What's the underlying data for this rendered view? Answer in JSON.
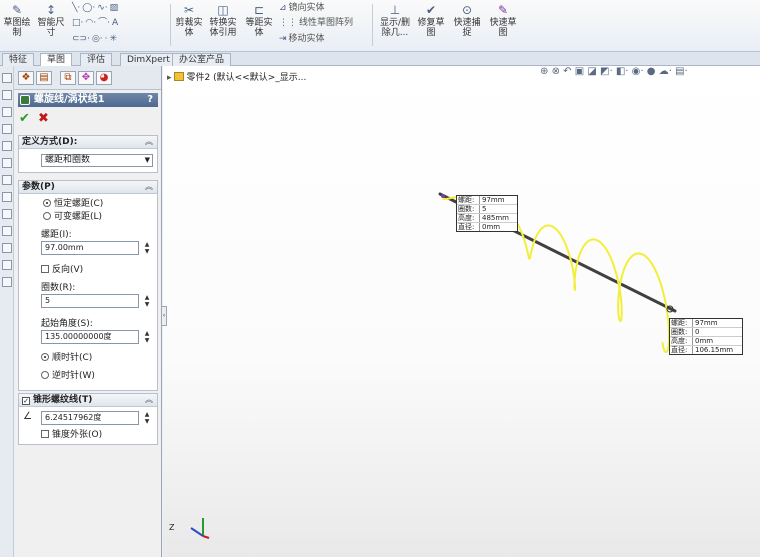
{
  "ribbon": {
    "buttons": [
      {
        "label": "草图绘\n制",
        "icon": "pencil-icon"
      },
      {
        "label": "智能尺\n寸",
        "icon": "dimension-icon"
      },
      {
        "label": "剪裁实\n体",
        "icon": "trim-icon"
      },
      {
        "label": "转换实\n体引用",
        "icon": "convert-icon"
      },
      {
        "label": "等距实\n体",
        "icon": "offset-icon"
      },
      {
        "label": "显示/删\n除几...",
        "icon": "relations-icon"
      },
      {
        "label": "修复草\n图",
        "icon": "repair-icon"
      },
      {
        "label": "快速捕\n捉",
        "icon": "snap-icon"
      },
      {
        "label": "快速草\n图",
        "icon": "rapid-sketch-icon"
      }
    ],
    "small": {
      "mirror": "镜向实体",
      "linear": "线性草图阵列",
      "move": "移动实体"
    }
  },
  "tabs": [
    "特征",
    "草图",
    "评估",
    "DimXpert",
    "办公室产品"
  ],
  "active_tab": "草图",
  "tree_label": "零件2 (默认<<默认>_显示...",
  "pm": {
    "title": "螺旋线/涡状线1",
    "help": "?",
    "define": {
      "header": "定义方式(D):",
      "value": "螺距和圈数"
    },
    "params": {
      "header": "参数(P)",
      "constant": "恒定螺距(C)",
      "variable": "可变螺距(L)",
      "pitch_label": "螺距(I):",
      "pitch_value": "97.00mm",
      "reverse": "反向(V)",
      "rev_label": "圈数(R):",
      "rev_value": "5",
      "angle_label": "起始角度(S):",
      "angle_value": "135.00000000度",
      "cw": "顺时针(C)",
      "ccw": "逆时针(W)"
    },
    "taper": {
      "header": "锥形螺纹线(T)",
      "angle_value": "6.24517962度",
      "outward": "锥度外张(O)"
    }
  },
  "callout_top": [
    {
      "k": "螺距:",
      "v": "97mm"
    },
    {
      "k": "圈数:",
      "v": "5"
    },
    {
      "k": "高度:",
      "v": "485mm"
    },
    {
      "k": "直径:",
      "v": "0mm"
    }
  ],
  "callout_bottom": [
    {
      "k": "螺距:",
      "v": "97mm"
    },
    {
      "k": "圈数:",
      "v": "0"
    },
    {
      "k": "高度:",
      "v": "0mm"
    },
    {
      "k": "直径:",
      "v": "106.15mm"
    }
  ],
  "colors": {
    "helix": "#f2ee3a",
    "axis": "#404040"
  }
}
